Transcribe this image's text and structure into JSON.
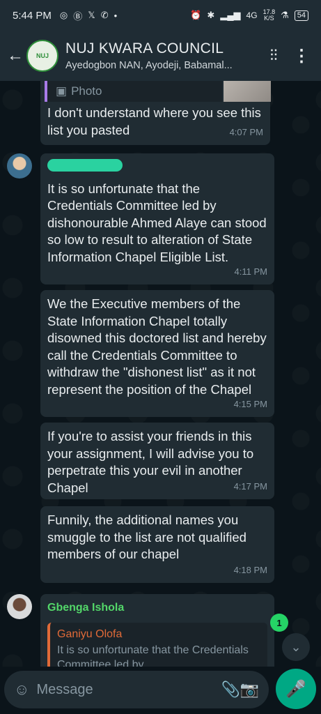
{
  "status_bar": {
    "time": "5:44 PM",
    "net_speed_value": "17.8",
    "net_speed_unit": "K/S",
    "signal_label": "4G",
    "battery": "54"
  },
  "header": {
    "title": "NUJ KWARA COUNCIL",
    "members": "Ayedogbon NAN, Ayodeji, Babamal...",
    "avatar_text": "NUJ"
  },
  "messages": [
    {
      "reply_label": "Photo",
      "text": "I don't understand where you see this list you pasted",
      "time": "4:07 PM"
    },
    {
      "text": "It is so unfortunate that the Credentials Committee led by dishonourable Ahmed Alaye can stood so low to result to alteration of State Information Chapel Eligible List.",
      "time": "4:11 PM"
    },
    {
      "text": "We the Executive members of the State Information Chapel totally disowned this doctored list and hereby call the Credentials Committee to withdraw the \"dishonest list\" as it not represent the position of the Chapel",
      "time": "4:15 PM"
    },
    {
      "text": "If you're to assist your friends in this your assignment, I will advise you to perpetrate this your evil in another Chapel",
      "time": "4:17 PM"
    },
    {
      "text": "Funnily, the additional names you smuggle to the list are not qualified members of our chapel",
      "time": "4:18 PM"
    },
    {
      "sender": "Gbenga Ishola",
      "quote_author": "Ganiyu Olofa",
      "quote_text": "It is so unfortunate that the Credentials Committee led by"
    }
  ],
  "unread_count": "1",
  "input": {
    "placeholder": "Message"
  },
  "colors": {
    "accent": "#00a884",
    "bubble": "#202c33",
    "background": "#0b141a"
  }
}
